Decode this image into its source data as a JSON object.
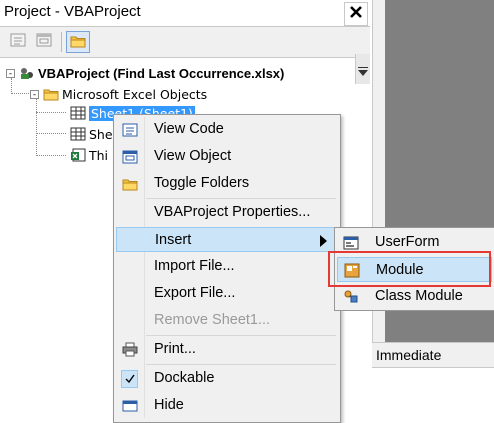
{
  "title_bar": {
    "title": "Project - VBAProject",
    "close_label": "✕"
  },
  "toolbar": {
    "buttons": [
      {
        "name": "view-code",
        "icon": "view-code-icon"
      },
      {
        "name": "view-object",
        "icon": "view-object-icon"
      },
      {
        "name": "toggle-folders",
        "icon": "folder-icon"
      }
    ]
  },
  "tree": {
    "root": {
      "label": "VBAProject (Find Last Occurrence.xlsx)",
      "expander": "-"
    },
    "folder": {
      "label": "Microsoft Excel Objects",
      "expander": "-"
    },
    "items": [
      {
        "label": "Sheet1 (Sheet1)",
        "selected": true
      },
      {
        "label": "She"
      },
      {
        "label": "Thi"
      }
    ]
  },
  "context_menu": {
    "items": [
      {
        "label": "View Code",
        "icon": "view-code-icon"
      },
      {
        "label": "View Object",
        "icon": "view-object-icon"
      },
      {
        "label": "Toggle Folders",
        "icon": "folder-icon"
      },
      {
        "label": "VBAProject Properties...",
        "icon": ""
      },
      {
        "label": "Insert",
        "icon": "",
        "submenu": true,
        "hover": true
      },
      {
        "label": "Import File...",
        "icon": ""
      },
      {
        "label": "Export File...",
        "icon": ""
      },
      {
        "label": "Remove Sheet1...",
        "icon": "",
        "disabled": true
      },
      {
        "label": "Print...",
        "icon": "printer-icon"
      },
      {
        "label": "Dockable",
        "icon": "checkmark-icon",
        "checked": true
      },
      {
        "label": "Hide",
        "icon": "hide-icon"
      }
    ]
  },
  "insert_submenu": {
    "items": [
      {
        "label": "UserForm",
        "icon": "userform-icon"
      },
      {
        "label": "Module",
        "icon": "module-icon",
        "hover": true
      },
      {
        "label": "Class Module",
        "icon": "class-module-icon"
      }
    ]
  },
  "immediate": {
    "title": "Immediate"
  },
  "colors": {
    "selection": "#3399ff",
    "menu_hover": "#cce4f7",
    "highlight_box": "#e53935",
    "code_area": "#808080"
  }
}
